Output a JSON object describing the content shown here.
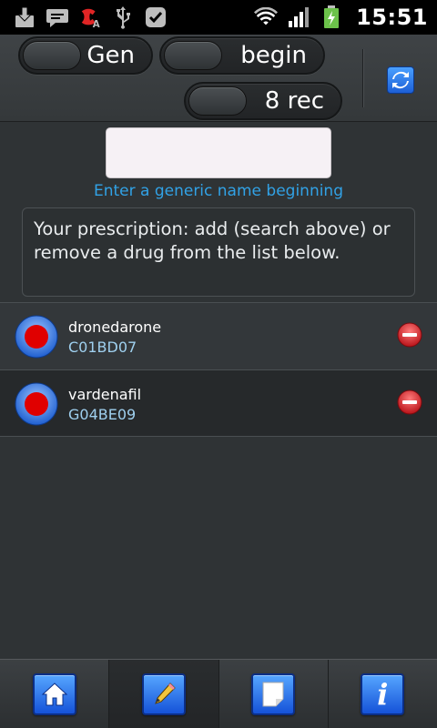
{
  "status_bar": {
    "left_icons": [
      "download-icon",
      "chat-icon",
      "missed-call-icon",
      "usb-icon",
      "check-icon"
    ],
    "right_icons": [
      "wifi-icon",
      "signal-icon",
      "battery-charging-icon"
    ],
    "time": "15:51"
  },
  "toolbar": {
    "toggle_gen_label": "Gen",
    "toggle_begin_label": "begin",
    "toggle_rec_label": "8 rec",
    "refresh_icon": "refresh-icon"
  },
  "search": {
    "value": "",
    "hint": "Enter a generic name beginning"
  },
  "prescription": {
    "text": "Your prescription: add (search above) or remove a drug from the list below."
  },
  "drugs": [
    {
      "name": "dronedarone",
      "code": "C01BD07"
    },
    {
      "name": "vardenafil",
      "code": "G04BE09"
    }
  ],
  "bottom_nav": {
    "tabs": [
      "home-icon",
      "pencil-icon",
      "note-icon",
      "info-icon"
    ],
    "active": "pencil-icon",
    "info_glyph": "i"
  },
  "colors": {
    "accent_blue": "#31a2e6",
    "button_blue": "#1552d8",
    "remove_red": "#d8262c"
  }
}
